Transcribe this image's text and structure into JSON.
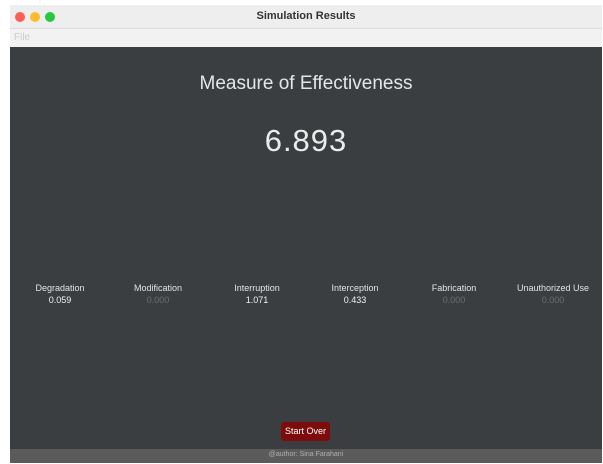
{
  "window": {
    "title": "Simulation Results"
  },
  "menu": {
    "file_label": "File"
  },
  "main": {
    "heading": "Measure of Effectiveness",
    "value": "6.893"
  },
  "metrics": [
    {
      "label": "Degradation",
      "value": "0.059"
    },
    {
      "label": "Modification",
      "value": "0.000"
    },
    {
      "label": "Interruption",
      "value": "1.071"
    },
    {
      "label": "Interception",
      "value": "0.433"
    },
    {
      "label": "Fabrication",
      "value": "0.000"
    },
    {
      "label": "Unauthorized Use",
      "value": "0.000"
    }
  ],
  "actions": {
    "start_over_label": "Start Over"
  },
  "footer": {
    "text": "@author: Sina Farahani"
  },
  "colors": {
    "content_bg": "#3b3e40",
    "button_bg": "#7d0c0c",
    "footer_bg": "#5b5b5b"
  }
}
